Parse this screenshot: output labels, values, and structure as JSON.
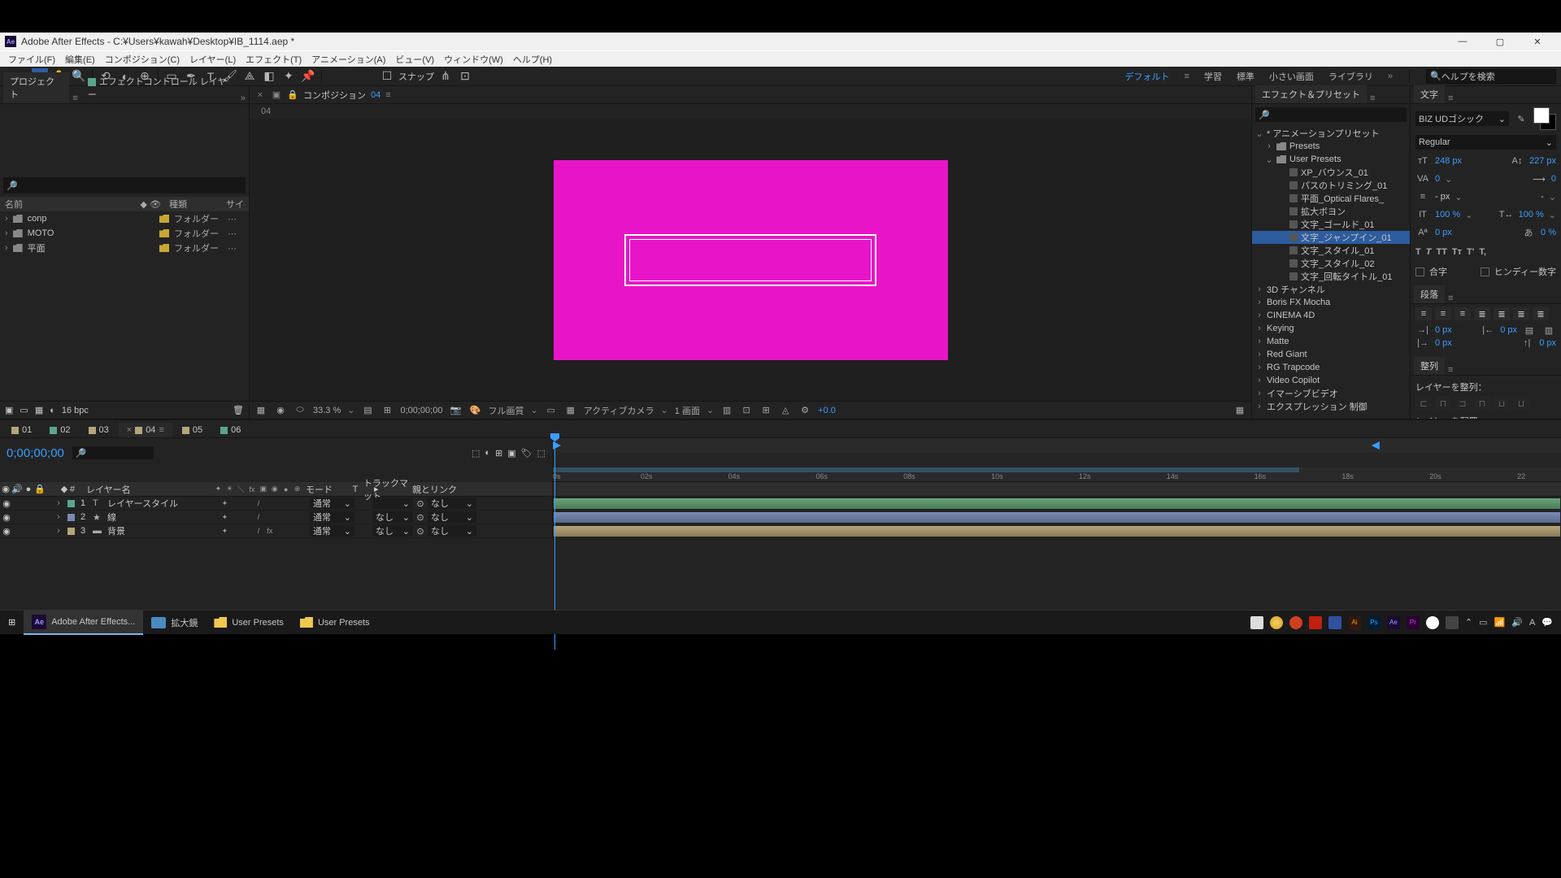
{
  "title": "Adobe After Effects - C:¥Users¥kawah¥Desktop¥IB_1114.aep *",
  "menu": [
    "ファイル(F)",
    "編集(E)",
    "コンポジション(C)",
    "レイヤー(L)",
    "エフェクト(T)",
    "アニメーション(A)",
    "ビュー(V)",
    "ウィンドウ(W)",
    "ヘルプ(H)"
  ],
  "toolbar": {
    "snap": "スナップ"
  },
  "workspaces": [
    "デフォルト",
    "学習",
    "標準",
    "小さい画面",
    "ライブラリ"
  ],
  "search_help": "ヘルプを検索",
  "project": {
    "tab": "プロジェクト",
    "fx_tab": "エフェクトコントロール レイヤー",
    "head_name": "名前",
    "head_type": "種類",
    "head_size": "サイ",
    "items": [
      {
        "name": "conp",
        "type": "フォルダー"
      },
      {
        "name": "MOTO",
        "type": "フォルダー"
      },
      {
        "name": "平面",
        "type": "フォルダー"
      }
    ],
    "bpc": "16 bpc"
  },
  "comp": {
    "tab": "コンポジション",
    "tab_num": "04",
    "bc": "04",
    "mag": "33.3 %",
    "time": "0;00;00;00",
    "quality": "フル画質",
    "camera": "アクティブカメラ",
    "view": "1 画面",
    "exp": "+0.0"
  },
  "effects_presets": {
    "title": "エフェクト＆プリセット",
    "tree": [
      {
        "chev": "v",
        "ind": 0,
        "folder": false,
        "label": "* アニメーションプリセット"
      },
      {
        "chev": ">",
        "ind": 1,
        "folder": true,
        "label": "Presets"
      },
      {
        "chev": "v",
        "ind": 1,
        "folder": true,
        "label": "User Presets"
      },
      {
        "chev": "",
        "ind": 2,
        "preset": true,
        "label": "XP_バウンス_01"
      },
      {
        "chev": "",
        "ind": 2,
        "preset": true,
        "label": "パスのトリミング_01"
      },
      {
        "chev": "",
        "ind": 2,
        "preset": true,
        "label": "平面_Optical Flares_"
      },
      {
        "chev": "",
        "ind": 2,
        "preset": true,
        "label": "拡大ボヨン"
      },
      {
        "chev": "",
        "ind": 2,
        "preset": true,
        "label": "文字_ゴールド_01"
      },
      {
        "chev": "",
        "ind": 2,
        "preset": true,
        "label": "文字_ジャンプイン_01",
        "sel": true
      },
      {
        "chev": "",
        "ind": 2,
        "preset": true,
        "label": "文字_スタイル_01"
      },
      {
        "chev": "",
        "ind": 2,
        "preset": true,
        "label": "文字_スタイル_02"
      },
      {
        "chev": "",
        "ind": 2,
        "preset": true,
        "label": "文字_回転タイトル_01"
      },
      {
        "chev": ">",
        "ind": 0,
        "label": "3D チャンネル"
      },
      {
        "chev": ">",
        "ind": 0,
        "label": "Boris FX Mocha"
      },
      {
        "chev": ">",
        "ind": 0,
        "label": "CINEMA 4D"
      },
      {
        "chev": ">",
        "ind": 0,
        "label": "Keying"
      },
      {
        "chev": ">",
        "ind": 0,
        "label": "Matte"
      },
      {
        "chev": ">",
        "ind": 0,
        "label": "Red Giant"
      },
      {
        "chev": ">",
        "ind": 0,
        "label": "RG Trapcode"
      },
      {
        "chev": ">",
        "ind": 0,
        "label": "Video Copilot"
      },
      {
        "chev": ">",
        "ind": 0,
        "label": "イマーシブビデオ"
      },
      {
        "chev": ">",
        "ind": 0,
        "label": "エクスプレッション 制御"
      }
    ]
  },
  "character": {
    "title": "文字",
    "font": "BIZ UDゴシック",
    "style": "Regular",
    "size": "248 px",
    "leading": "227 px",
    "va": "0",
    "tracking": "0",
    "dash_px": "- px",
    "dash": "-",
    "scale_v": "100 %",
    "scale_h": "100 %",
    "baseline": "0 px",
    "tsume": "0 %",
    "ligature": "合字",
    "hindi": "ヒンディー数字"
  },
  "paragraph": {
    "title": "段落",
    "zero_px": "0 px"
  },
  "align": {
    "title": "整列",
    "align_to": "レイヤーを整列：",
    "distribute": "レイヤーを配置："
  },
  "timeline": {
    "tabs": [
      {
        "num": "01",
        "color": "#b5a57a"
      },
      {
        "num": "02",
        "color": "#5aa590"
      },
      {
        "num": "03",
        "color": "#b5a57a"
      },
      {
        "num": "04",
        "color": "#b5a57a",
        "active": true
      },
      {
        "num": "05",
        "color": "#b5a57a"
      },
      {
        "num": "06",
        "color": "#5aa590"
      }
    ],
    "timecode": "0;00;00;00",
    "col_num": "#",
    "col_name": "レイヤー名",
    "col_mode": "モード",
    "col_t": "T",
    "col_trk": "トラックマット",
    "col_parent": "親とリンク",
    "layers": [
      {
        "num": "1",
        "color": "#5aa590",
        "ico": "T",
        "name": "レイヤースタイル",
        "mode": "通常",
        "trk": "",
        "parent": "なし"
      },
      {
        "num": "2",
        "color": "#7a8ab5",
        "ico": "★",
        "name": "線",
        "mode": "通常",
        "trk": "なし",
        "parent": "なし"
      },
      {
        "num": "3",
        "color": "#b5a57a",
        "ico": "",
        "name": "背景",
        "mode": "通常",
        "trk": "なし",
        "parent": "なし"
      }
    ],
    "ticks": [
      "0s",
      "02s",
      "04s",
      "06s",
      "08s",
      "10s",
      "12s",
      "14s",
      "16s",
      "18s",
      "20s",
      "22"
    ]
  },
  "taskbar": {
    "ae": "Adobe After Effects...",
    "mag": "拡大鏡",
    "up1": "User Presets",
    "up2": "User Presets"
  }
}
